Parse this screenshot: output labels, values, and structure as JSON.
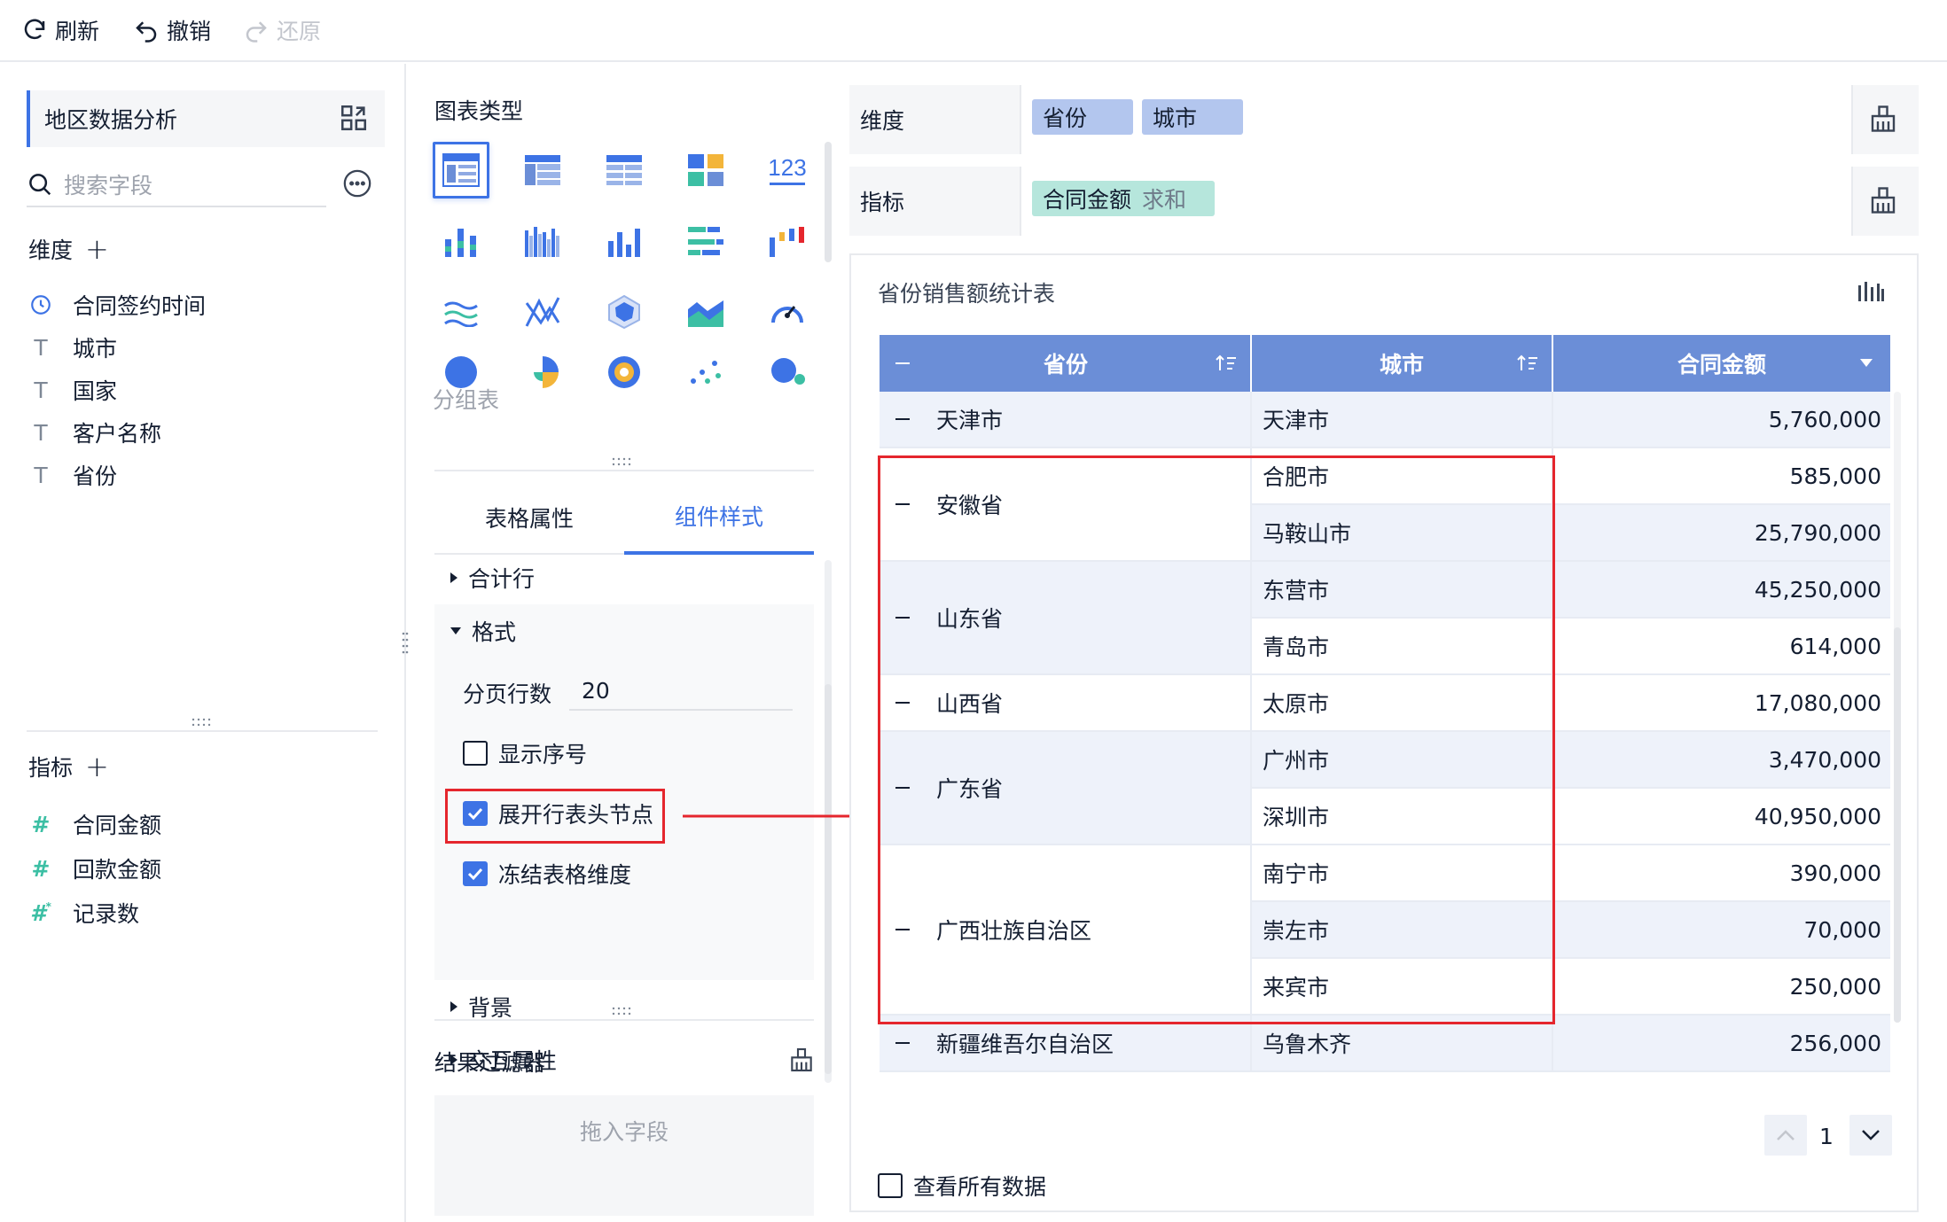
{
  "toolbar": {
    "refresh": "刷新",
    "undo": "撤销",
    "redo": "还原"
  },
  "left": {
    "dataset_title": "地区数据分析",
    "search_placeholder": "搜索字段",
    "dimension_title": "维度",
    "dimensions": [
      {
        "label": "合同签约时间",
        "icon": "clock-icon"
      },
      {
        "label": "城市",
        "icon": "text-field-icon"
      },
      {
        "label": "国家",
        "icon": "text-field-icon"
      },
      {
        "label": "客户名称",
        "icon": "text-field-icon"
      },
      {
        "label": "省份",
        "icon": "text-field-icon"
      }
    ],
    "measure_title": "指标",
    "measures": [
      {
        "label": "合同金额",
        "icon": "number-field-icon"
      },
      {
        "label": "回款金额",
        "icon": "number-field-icon"
      },
      {
        "label": "记录数",
        "icon": "count-field-icon"
      }
    ]
  },
  "middle": {
    "chart_type_title": "图表类型",
    "chart_type_tooltip": "分组表",
    "tabs": [
      "表格属性",
      "组件样式"
    ],
    "sections": {
      "total_row": "合计行",
      "format": "格式",
      "background": "背景",
      "interaction": "交互属性"
    },
    "format": {
      "page_rows_label": "分页行数",
      "page_rows_value": "20",
      "show_index": "显示序号",
      "expand_row_header": "展开行表头节点",
      "freeze_dimension": "冻结表格维度"
    },
    "filter_title": "结果过滤器",
    "filter_placeholder": "拖入字段"
  },
  "right": {
    "dimension_label": "维度",
    "dimension_pills": [
      "省份",
      "城市"
    ],
    "measure_label": "指标",
    "measure_pill": {
      "name": "合同金额",
      "agg": "求和"
    },
    "chart_title": "省份销售额统计表",
    "table": {
      "headers": [
        "省份",
        "城市",
        "合同金额"
      ],
      "rows": [
        {
          "province": "天津市",
          "cities": [
            {
              "city": "天津市",
              "amount": "5,760,000"
            }
          ]
        },
        {
          "province": "安徽省",
          "cities": [
            {
              "city": "合肥市",
              "amount": "585,000"
            },
            {
              "city": "马鞍山市",
              "amount": "25,790,000"
            }
          ]
        },
        {
          "province": "山东省",
          "cities": [
            {
              "city": "东营市",
              "amount": "45,250,000"
            },
            {
              "city": "青岛市",
              "amount": "614,000"
            }
          ]
        },
        {
          "province": "山西省",
          "cities": [
            {
              "city": "太原市",
              "amount": "17,080,000"
            }
          ]
        },
        {
          "province": "广东省",
          "cities": [
            {
              "city": "广州市",
              "amount": "3,470,000"
            },
            {
              "city": "深圳市",
              "amount": "40,950,000"
            }
          ]
        },
        {
          "province": "广西壮族自治区",
          "cities": [
            {
              "city": "南宁市",
              "amount": "390,000"
            },
            {
              "city": "崇左市",
              "amount": "70,000"
            },
            {
              "city": "来宾市",
              "amount": "250,000"
            }
          ]
        },
        {
          "province": "新疆维吾尔自治区",
          "cities": [
            {
              "city": "乌鲁木齐",
              "amount": "256,000"
            }
          ]
        }
      ]
    },
    "page_number": "1",
    "view_all": "查看所有数据"
  },
  "colors": {
    "accent": "#3d73e5",
    "header_bg": "#6b8ed7",
    "highlight": "#e5262d"
  }
}
